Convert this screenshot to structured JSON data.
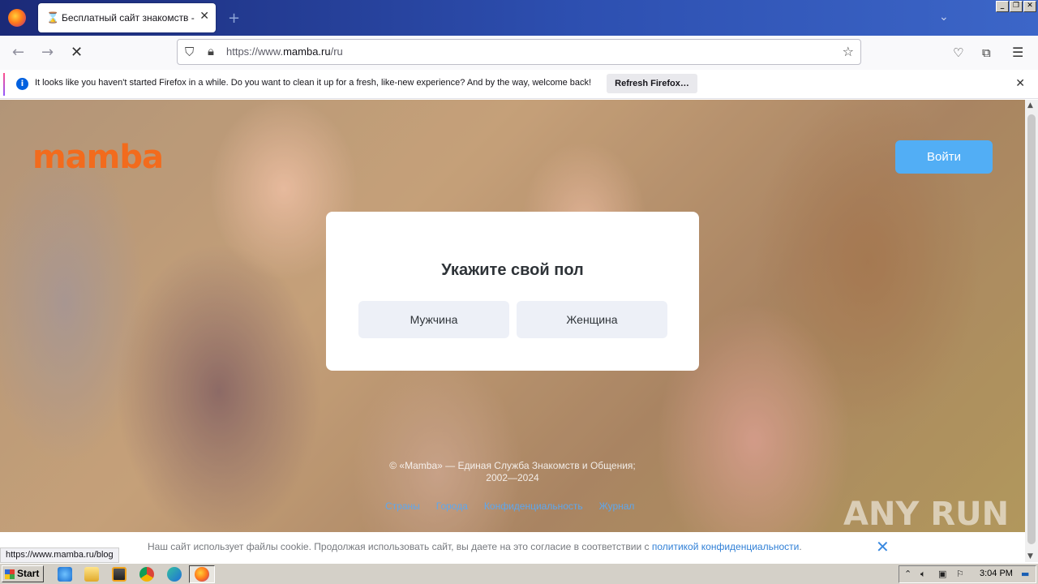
{
  "browser": {
    "tab_title": "Бесплатный сайт знакомств - регистрация",
    "url_prefix": "https://www.",
    "url_domain": "mamba.ru",
    "url_path": "/ru",
    "notification_text": "It looks like you haven't started Firefox in a while. Do you want to clean it up for a fresh, like-new experience? And by the way, welcome back!",
    "notification_button": "Refresh Firefox…",
    "status_url": "https://www.mamba.ru/blog"
  },
  "page": {
    "logo": "mamba",
    "login_button": "Войти",
    "modal_title": "Укажите свой пол",
    "male_button": "Мужчина",
    "female_button": "Женщина",
    "footer_line1": "© «Mamba» — Единая Служба Знакомств и Общения;",
    "footer_line2": "2002—2024",
    "footer_links": [
      "Страны",
      "Города",
      "Конфиденциальность",
      "Журнал"
    ],
    "cookie_text": "Наш сайт использует файлы cookie. Продолжая использовать сайт, вы даете на это согласие в соответствии с ",
    "cookie_link": "политикой конфиденциальности",
    "cookie_end": ".",
    "watermark": "ANY RUN"
  },
  "taskbar": {
    "start": "Start",
    "clock": "3:04 PM"
  },
  "colors": {
    "brand": "#f26b1d",
    "login": "#52aef5",
    "link": "#5ea7ee"
  }
}
